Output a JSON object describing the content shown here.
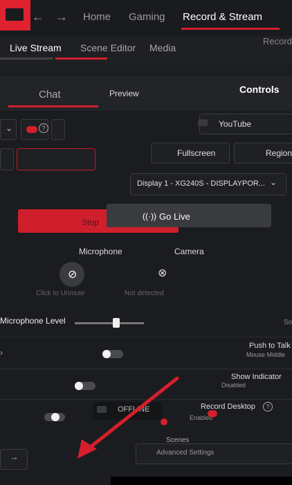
{
  "nav": {
    "items": [
      "Home",
      "Gaming",
      "Record & Stream"
    ],
    "active": "Record & Stream"
  },
  "subnav": {
    "items": [
      "Live Stream",
      "Scene Editor",
      "Media"
    ],
    "cut_item": "Record"
  },
  "tabs": {
    "chat": "Chat",
    "preview": "Preview"
  },
  "controls": {
    "title": "Controls",
    "platform": "YouTube",
    "fullscreen": "Fullscreen",
    "region": "Region",
    "display": "Display 1 - XG240S - DISPLAYPOR...",
    "go_live": "Go Live",
    "stop": "Stop"
  },
  "devices": {
    "microphone": "Microphone",
    "camera": "Camera",
    "mic_status": "Click to Unmute",
    "cam_status": "Not detected"
  },
  "settings": {
    "mic_level": "Microphone Level",
    "mic_level_value": 0.6,
    "so_cut": "So",
    "push_to_talk": "Push to Talk",
    "push_to_talk_sub": "Mouse Middle",
    "show_indicator": "Show Indicator",
    "show_indicator_sub": "Disabled",
    "offline": "OFFLINE",
    "record_desktop": "Record Desktop",
    "record_desktop_sub": "Enabled",
    "scenes": "Scenes",
    "advanced": "Advanced Settings"
  },
  "colors": {
    "accent": "#d41f2c",
    "bg": "#1d1e21"
  },
  "icons": [
    "back-icon",
    "forward-icon",
    "chevron-down-icon",
    "help-icon",
    "microphone-muted-icon",
    "camera-off-icon",
    "broadcast-icon",
    "youtube-icon",
    "arrow-right-icon"
  ]
}
